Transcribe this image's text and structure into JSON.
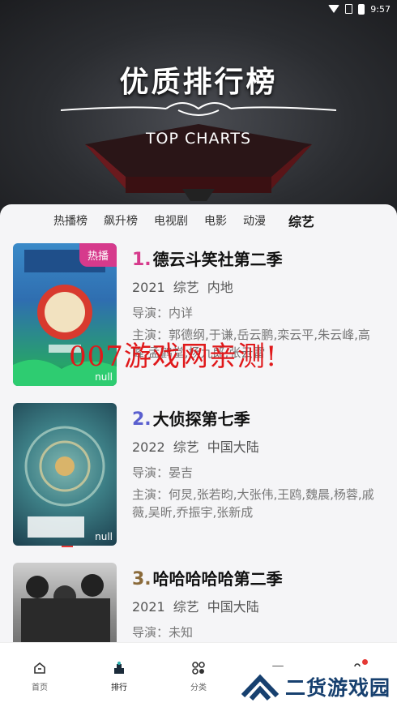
{
  "status": {
    "time": "9:57"
  },
  "hero": {
    "title": "优质排行榜",
    "subtitle": "TOP CHARTS"
  },
  "tabs": [
    "热播榜",
    "飙升榜",
    "电视剧",
    "电影",
    "动漫",
    "综艺"
  ],
  "active_tab": "综艺",
  "items": [
    {
      "rank": "1.",
      "rank_color": "#d63a8c",
      "title": "德云斗笑社第二季",
      "year": "2021",
      "genre": "综艺",
      "region": "内地",
      "director": "导演：内详",
      "cast": "主演：郭德纲,于谦,岳云鹏,栾云平,朱云峰,高峰,孟鹤堂,杨九郎,张云雷",
      "badge": "热播",
      "null_tag": "null"
    },
    {
      "rank": "2.",
      "rank_color": "#5a5fcf",
      "title": "大侦探第七季",
      "year": "2022",
      "genre": "综艺",
      "region": "中国大陆",
      "director": "导演：晏吉",
      "cast": "主演：何炅,张若昀,大张伟,王鸥,魏晨,杨蓉,戚薇,吴昕,乔振宇,张新成",
      "null_tag": "null"
    },
    {
      "rank": "3.",
      "rank_color": "#8a6a3a",
      "title": "哈哈哈哈哈第二季",
      "year": "2021",
      "genre": "综艺",
      "region": "中国大陆",
      "director": "导演：未知"
    }
  ],
  "watermark": "007游戏网亲测!",
  "nav": [
    "首页",
    "排行",
    "分类",
    "",
    ""
  ],
  "logo_watermark": "二货游戏园",
  "colors": {
    "accent": "#d63a8c",
    "nav_dot": "#e53935"
  }
}
